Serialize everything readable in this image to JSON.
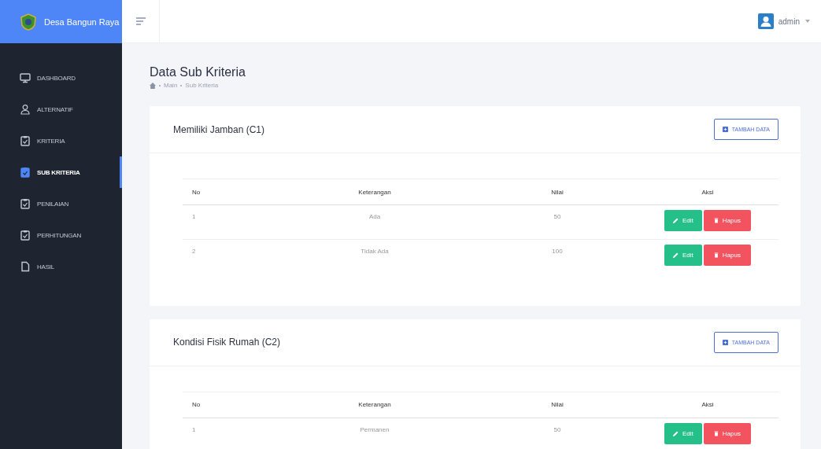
{
  "brand": {
    "name": "Desa Bangun Raya"
  },
  "user": {
    "name": "admin"
  },
  "sidebar": {
    "items": [
      {
        "label": "DASHBOARD",
        "kind": "monitor",
        "selected": false
      },
      {
        "label": "ALTERNATIF",
        "kind": "user",
        "selected": false
      },
      {
        "label": "KRITERIA",
        "kind": "clipboard",
        "selected": false
      },
      {
        "label": "SUB KRITERIA",
        "kind": "clipboard",
        "selected": true
      },
      {
        "label": "PENILAIAN",
        "kind": "clipboard",
        "selected": false
      },
      {
        "label": "PERHITUNGAN",
        "kind": "clipboard",
        "selected": false
      },
      {
        "label": "HASIL",
        "kind": "file",
        "selected": false
      }
    ]
  },
  "page": {
    "title": "Data Sub Kriteria",
    "breadcrumb": [
      "Main",
      "Sub Kriteria"
    ]
  },
  "cards": [
    {
      "title": "Memiliki Jamban (C1)",
      "add_button": "TAMBAH DATA",
      "columns": [
        "No",
        "Keterangan",
        "Nilai",
        "Aksi"
      ],
      "rows": [
        {
          "no": "1",
          "keterangan": "Ada",
          "nilai": "50",
          "actions": [
            "Edit",
            "Hapus"
          ]
        },
        {
          "no": "2",
          "keterangan": "Tidak Ada",
          "nilai": "100",
          "actions": [
            "Edit",
            "Hapus"
          ]
        }
      ]
    },
    {
      "title": "Kondisi Fisik Rumah (C2)",
      "add_button": "TAMBAH DATA",
      "columns": [
        "No",
        "Keterangan",
        "Nilai",
        "Aksi"
      ],
      "rows": [
        {
          "no": "1",
          "keterangan": "Permanen",
          "nilai": "50",
          "actions": [
            "Edit",
            "Hapus"
          ]
        }
      ]
    }
  ]
}
